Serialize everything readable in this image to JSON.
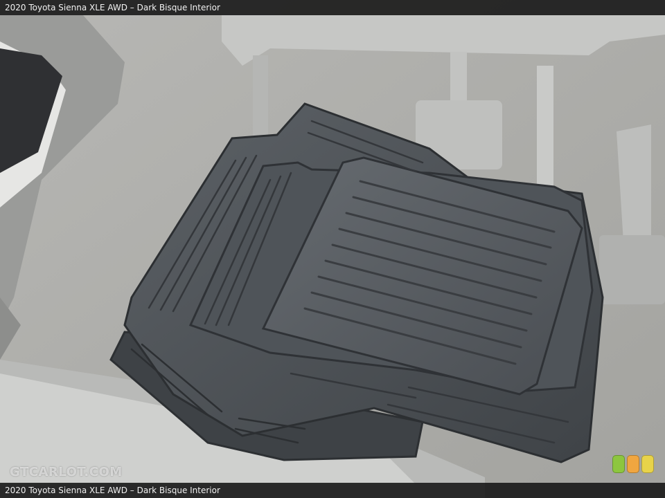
{
  "caption_top": "2020 Toyota Sienna XLE AWD – Dark Bisque Interior",
  "caption_bottom": "2020 Toyota Sienna XLE AWD – Dark Bisque Interior",
  "watermark": "GTCARLOT.COM",
  "badge": {
    "colors": [
      "#8dc63f",
      "#f0a640",
      "#e8d34a"
    ]
  },
  "photo": {
    "subject": "stacked-rubber-floor-mats-icon",
    "colors": {
      "carpet": "#a9a9a6",
      "mat": "#4d5257",
      "seat-rail": "#c8c9c7"
    }
  }
}
